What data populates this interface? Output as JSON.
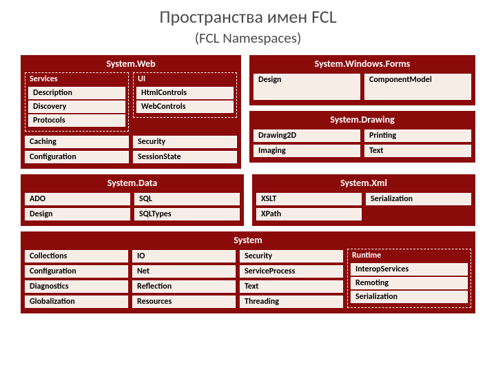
{
  "title_ru": "Пространства имен FCL",
  "title_en": "(FCL Namespaces)",
  "system_web": {
    "title": "System.Web",
    "services_label": "Services",
    "services": [
      "Description",
      "Discovery",
      "Protocols"
    ],
    "ui_label": "UI",
    "ui": [
      "HtmlControls",
      "WebControls"
    ],
    "left_extras": [
      "Caching",
      "Configuration"
    ],
    "right_extras": [
      "Security",
      "SessionState"
    ]
  },
  "system_windows_forms": {
    "title": "System.Windows.Forms",
    "items": [
      "Design",
      "ComponentModel"
    ]
  },
  "system_drawing": {
    "title": "System.Drawing",
    "left": [
      "Drawing2D",
      "Imaging"
    ],
    "right": [
      "Printing",
      "Text"
    ]
  },
  "system_data": {
    "title": "System.Data",
    "left": [
      "ADO",
      "Design"
    ],
    "right": [
      "SQL",
      "SQLTypes"
    ]
  },
  "system_xml": {
    "title": "System.Xml",
    "left": [
      "XSLT",
      "XPath"
    ],
    "right": [
      "Serialization"
    ]
  },
  "system": {
    "title": "System",
    "c1": [
      "Collections",
      "Configuration",
      "Diagnostics",
      "Globalization"
    ],
    "c2": [
      "IO",
      "Net",
      "Reflection",
      "Resources"
    ],
    "c3": [
      "Security",
      "ServiceProcess",
      "Text",
      "Threading"
    ],
    "runtime_label": "Runtime",
    "runtime": [
      "InteropServices",
      "Remoting",
      "Serialization"
    ]
  }
}
